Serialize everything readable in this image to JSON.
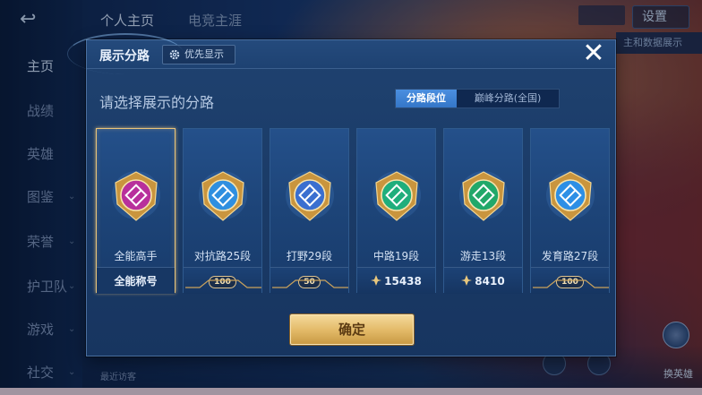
{
  "background": {
    "top_tabs": [
      "个人主页",
      "电竞主涯"
    ],
    "settings_label": "设置",
    "right_label": "主和数据展示",
    "nav": [
      {
        "label": "主页",
        "active": true,
        "chevron": false
      },
      {
        "label": "战绩",
        "active": false,
        "chevron": false
      },
      {
        "label": "英雄",
        "active": false,
        "chevron": false
      },
      {
        "label": "图鉴",
        "active": false,
        "chevron": true
      },
      {
        "label": "荣誉",
        "active": false,
        "chevron": true
      },
      {
        "label": "护卫队",
        "active": false,
        "chevron": true
      },
      {
        "label": "游戏",
        "active": false,
        "chevron": true
      },
      {
        "label": "社交",
        "active": false,
        "chevron": true
      }
    ],
    "recent_visitors": "最近访客",
    "swap_hero": "换英雄"
  },
  "modal": {
    "title": "展示分路",
    "priority_label": "优先显示",
    "close_label": "✕",
    "prompt": "请选择展示的分路",
    "toggle": {
      "options": [
        "分路段位",
        "巅峰分路(全国)"
      ],
      "selected_index": 0
    },
    "cards": [
      {
        "name": "全能高手",
        "stat": "全能称号",
        "stat_type": "title",
        "badge_color": "#b8309c",
        "selected": true
      },
      {
        "name": "对抗路25段",
        "stat": "100",
        "stat_type": "pill",
        "badge_color": "#2f8fe0",
        "selected": false
      },
      {
        "name": "打野29段",
        "stat": "50",
        "stat_type": "pill",
        "badge_color": "#3a6fd0",
        "selected": false
      },
      {
        "name": "中路19段",
        "stat": "15438",
        "stat_type": "points",
        "badge_color": "#1fae7c",
        "selected": false
      },
      {
        "name": "游走13段",
        "stat": "8410",
        "stat_type": "points",
        "badge_color": "#21a86a",
        "selected": false
      },
      {
        "name": "发育路27段",
        "stat": "100",
        "stat_type": "pill",
        "badge_color": "#2d8fe6",
        "selected": false
      }
    ],
    "confirm_label": "确定"
  },
  "colors": {
    "accent_gold": "#e4bb6a",
    "toggle_blue": "#3f84d8",
    "modal_bg": "#1c3d69"
  }
}
